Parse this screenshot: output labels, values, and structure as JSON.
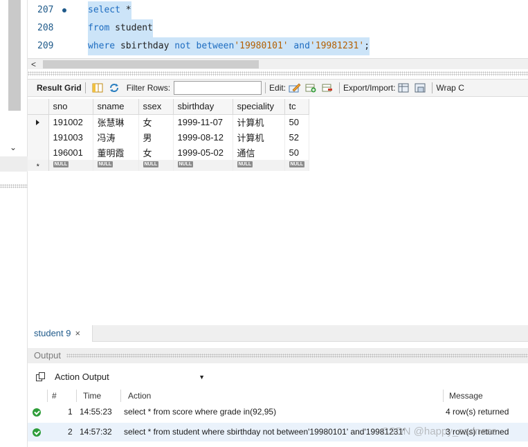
{
  "editor": {
    "lines": [
      {
        "num": "207",
        "breakpoint": true,
        "tokens": [
          {
            "t": "select",
            "c": "kw"
          },
          {
            "t": " *",
            "c": "id"
          }
        ]
      },
      {
        "num": "208",
        "breakpoint": false,
        "tokens": [
          {
            "t": "from",
            "c": "kw"
          },
          {
            "t": " student",
            "c": "id"
          }
        ]
      },
      {
        "num": "209",
        "breakpoint": false,
        "tokens": [
          {
            "t": "where",
            "c": "kw"
          },
          {
            "t": " sbirthday ",
            "c": "id"
          },
          {
            "t": "not between",
            "c": "kw"
          },
          {
            "t": "'19980101'",
            "c": "str"
          },
          {
            "t": " and",
            "c": "kw"
          },
          {
            "t": "'19981231'",
            "c": "str"
          },
          {
            "t": ";",
            "c": "id"
          }
        ]
      }
    ]
  },
  "result_toolbar": {
    "result_grid_label": "Result Grid",
    "filter_rows_label": "Filter Rows:",
    "filter_rows_value": "",
    "edit_label": "Edit:",
    "export_import_label": "Export/Import:",
    "wrap_label": "Wrap C"
  },
  "grid": {
    "columns": [
      "sno",
      "sname",
      "ssex",
      "sbirthday",
      "speciality",
      "tc"
    ],
    "rows": [
      [
        "191002",
        "张慧琳",
        "女",
        "1999-11-07",
        "计算机",
        "50"
      ],
      [
        "191003",
        "冯涛",
        "男",
        "1999-08-12",
        "计算机",
        "52"
      ],
      [
        "196001",
        "董明霞",
        "女",
        "1999-05-02",
        "通信",
        "50"
      ]
    ],
    "null_label": "NULL",
    "new_row_marker": "*"
  },
  "tabs": [
    {
      "label": "student 9",
      "close": "×"
    }
  ],
  "output": {
    "header": "Output",
    "mode": "Action Output",
    "columns": {
      "num": "#",
      "time": "Time",
      "action": "Action",
      "message": "Message"
    },
    "rows": [
      {
        "num": "1",
        "time": "14:55:23",
        "action": "select * from score where grade in(92,95)",
        "message": "4 row(s) returned"
      },
      {
        "num": "2",
        "time": "14:57:32",
        "action": "select * from student where sbirthday not between'19980101' and'19981231'",
        "message": "3 row(s) returned"
      }
    ]
  },
  "watermark": "CSDN @happy_sadness",
  "colors": {
    "keyword": "#1d6cc0",
    "string": "#b35f00",
    "selection": "#cce4f8",
    "ok": "#2e9d3a"
  }
}
